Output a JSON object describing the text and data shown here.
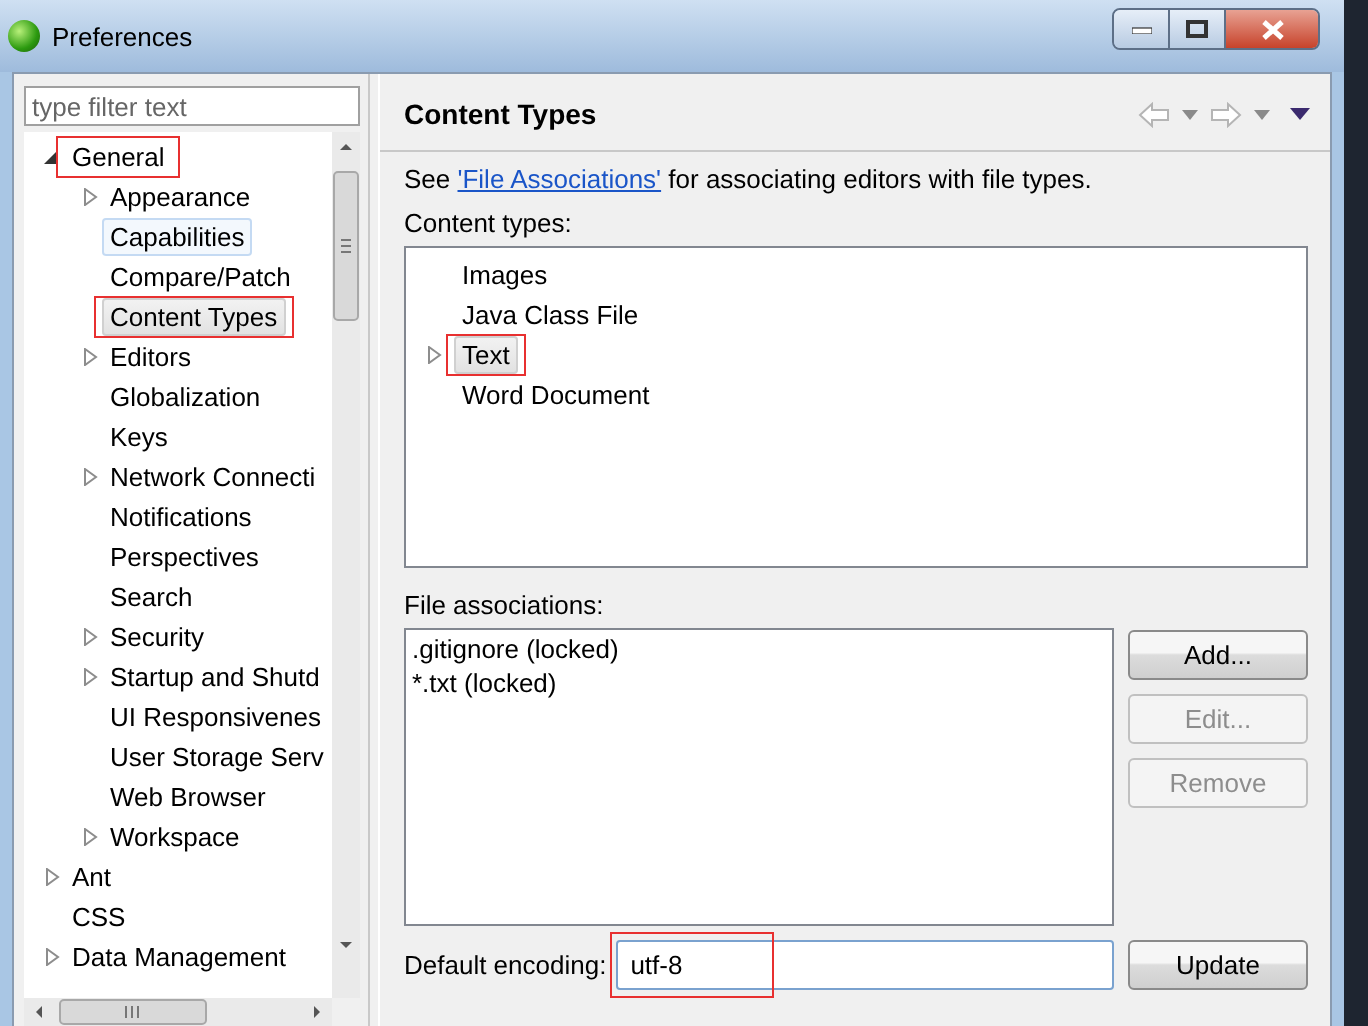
{
  "window": {
    "title": "Preferences"
  },
  "filter": {
    "placeholder": "type filter text"
  },
  "tree": [
    {
      "label": "General",
      "expanded": true,
      "selected": false,
      "hovered": false,
      "annotated": true,
      "children": [
        {
          "label": "Appearance",
          "expanded": false,
          "selected": false,
          "hovered": false,
          "annotated": false
        },
        {
          "label": "Capabilities",
          "selected": false,
          "hovered": true,
          "annotated": false
        },
        {
          "label": "Compare/Patch",
          "selected": false,
          "hovered": false,
          "annotated": false
        },
        {
          "label": "Content Types",
          "selected": true,
          "hovered": false,
          "annotated": true
        },
        {
          "label": "Editors",
          "expanded": false,
          "selected": false,
          "hovered": false,
          "annotated": false
        },
        {
          "label": "Globalization",
          "selected": false,
          "hovered": false,
          "annotated": false
        },
        {
          "label": "Keys",
          "selected": false,
          "hovered": false,
          "annotated": false
        },
        {
          "label": "Network Connecti",
          "expanded": false,
          "selected": false,
          "hovered": false,
          "annotated": false
        },
        {
          "label": "Notifications",
          "selected": false,
          "hovered": false,
          "annotated": false
        },
        {
          "label": "Perspectives",
          "selected": false,
          "hovered": false,
          "annotated": false
        },
        {
          "label": "Search",
          "selected": false,
          "hovered": false,
          "annotated": false
        },
        {
          "label": "Security",
          "expanded": false,
          "selected": false,
          "hovered": false,
          "annotated": false
        },
        {
          "label": "Startup and Shutd",
          "expanded": false,
          "selected": false,
          "hovered": false,
          "annotated": false
        },
        {
          "label": "UI Responsivenes",
          "selected": false,
          "hovered": false,
          "annotated": false
        },
        {
          "label": "User Storage Serv",
          "selected": false,
          "hovered": false,
          "annotated": false
        },
        {
          "label": "Web Browser",
          "selected": false,
          "hovered": false,
          "annotated": false
        },
        {
          "label": "Workspace",
          "expanded": false,
          "selected": false,
          "hovered": false,
          "annotated": false
        }
      ]
    },
    {
      "label": "Ant",
      "expanded": false,
      "selected": false,
      "hovered": false,
      "annotated": false
    },
    {
      "label": "CSS",
      "selected": false,
      "hovered": false,
      "annotated": false
    },
    {
      "label": "Data Management",
      "expanded": false,
      "selected": false,
      "hovered": false,
      "annotated": false
    }
  ],
  "page": {
    "title": "Content Types",
    "intro": {
      "before": "See ",
      "link": "'File Associations'",
      "after": " for associating editors with file types."
    },
    "content_types_label": "Content types:",
    "content_types": [
      {
        "label": "Images",
        "selected": false,
        "annotated": false
      },
      {
        "label": "Java Class File",
        "selected": false,
        "annotated": false
      },
      {
        "label": "Text",
        "expanded": false,
        "selected": true,
        "annotated": true
      },
      {
        "label": "Word Document",
        "selected": false,
        "annotated": false
      }
    ],
    "file_associations_label": "File associations:",
    "file_associations": [
      ".gitignore (locked)",
      "*.txt (locked)"
    ],
    "buttons": [
      {
        "label": "Add...",
        "disabled": false
      },
      {
        "label": "Edit...",
        "disabled": true
      },
      {
        "label": "Remove",
        "disabled": true
      }
    ],
    "encoding": {
      "label": "Default encoding:",
      "value": "utf-8",
      "annotated": true
    },
    "update_button": {
      "label": "Update",
      "disabled": false
    }
  }
}
